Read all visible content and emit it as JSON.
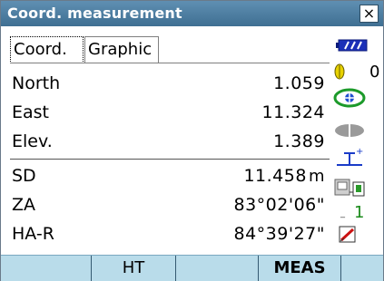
{
  "window": {
    "title": "Coord. measurement"
  },
  "tabs": [
    {
      "label": "Coord.",
      "active": true
    },
    {
      "label": "Graphic",
      "active": false
    }
  ],
  "coords": [
    {
      "label": "North",
      "value": "1.059"
    },
    {
      "label": "East",
      "value": "11.324"
    },
    {
      "label": "Elev.",
      "value": "1.389"
    }
  ],
  "measurements": [
    {
      "label": "SD",
      "value": "11.458",
      "unit": "m"
    },
    {
      "label": "ZA",
      "value": "83°02'06\""
    },
    {
      "label": "HA-R",
      "value": "84°39'27\""
    }
  ],
  "status": {
    "prism_constant": "0",
    "tilt_count": "1",
    "battery_icon": "battery-icon",
    "target_icon": "prism-target-icon",
    "laser_icon": "laser-beam-icon",
    "tilt_icon": "tilt-correction-icon",
    "comm_icon": "communication-icon",
    "input_icon": "input-mode-icon",
    "accent_color": "#4f7fa2",
    "softkey_bar_color": "#b9dcea"
  },
  "softkeys": [
    "",
    "HT",
    "",
    "MEAS",
    ""
  ]
}
